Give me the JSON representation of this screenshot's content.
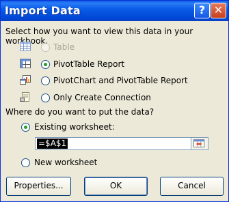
{
  "window": {
    "title": "Import Data",
    "help_glyph": "?",
    "close_glyph": "✕"
  },
  "view": {
    "prompt": "Select how you want to view this data in your workbook.",
    "options": [
      {
        "label": "Table",
        "icon": "table-icon",
        "checked": false,
        "disabled": true
      },
      {
        "label": "PivotTable Report",
        "icon": "pivottable-icon",
        "checked": true,
        "disabled": false
      },
      {
        "label": "PivotChart and PivotTable Report",
        "icon": "pivotchart-icon",
        "checked": false,
        "disabled": false
      },
      {
        "label": "Only Create Connection",
        "icon": "connection-icon",
        "checked": false,
        "disabled": false
      }
    ]
  },
  "destination": {
    "prompt": "Where do you want to put the data?",
    "existing_label": "Existing worksheet:",
    "existing_checked": true,
    "range_value": "=$A$1",
    "new_label": "New worksheet",
    "new_checked": false
  },
  "buttons": {
    "properties": "Properties...",
    "ok": "OK",
    "cancel": "Cancel"
  },
  "colors": {
    "title_bar": "#0a5ce6",
    "dialog_bg": "#ece9d8",
    "radio_dot": "#21a121"
  }
}
